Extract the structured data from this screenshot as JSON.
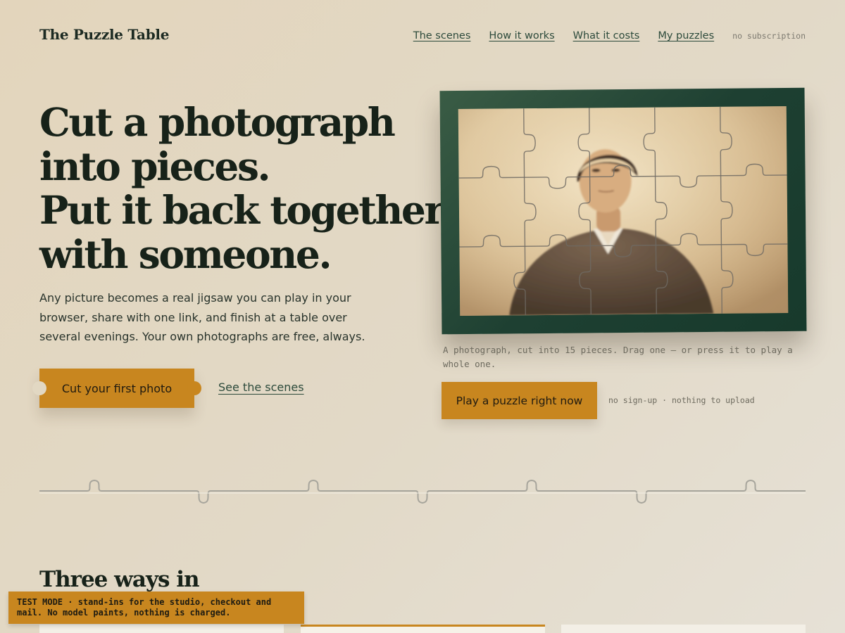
{
  "header": {
    "brand": "The Puzzle Table",
    "nav": [
      {
        "label": "The scenes"
      },
      {
        "label": "How it works"
      },
      {
        "label": "What it costs"
      },
      {
        "label": "My puzzles"
      }
    ],
    "note": "no subscription"
  },
  "hero": {
    "title_lines": [
      "Cut a photograph",
      "into pieces.",
      "Put it back together",
      "with someone."
    ],
    "description": "Any picture becomes a real jigsaw you can play in your browser, share with one link, and finish at a table over several evenings. Your own photographs are free, always.",
    "primary_cta": "Cut your first photo",
    "secondary_cta": "See the scenes"
  },
  "demo": {
    "caption": "A photograph, cut into 15 pieces. Drag one — or press it to play a whole one.",
    "play_cta": "Play a puzzle right now",
    "play_note": "no sign-up · nothing to upload",
    "piece_count": 15,
    "grid": {
      "columns": 5,
      "rows": 3
    }
  },
  "section": {
    "title": "Three ways in"
  },
  "banner": {
    "text": "TEST MODE · stand-ins for the studio, checkout and mail. No model paints, nothing is charged."
  },
  "colors": {
    "accent": "#c8861f",
    "frame_green": "#1e4032",
    "ink": "#172219",
    "link": "#2c4a3b",
    "background": "#e2d8c3"
  }
}
